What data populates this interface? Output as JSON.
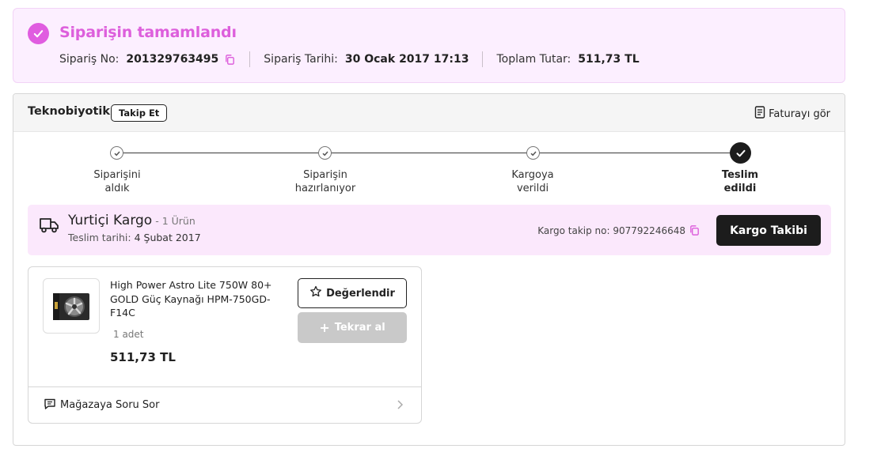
{
  "banner": {
    "title": "Siparişin tamamlandı",
    "order_no_label": "Sipariş No:",
    "order_no": "201329763495",
    "order_date_label": "Sipariş Tarihi:",
    "order_date": "30 Ocak 2017 17:13",
    "total_label": "Toplam Tutar:",
    "total": "511,73 TL",
    "accent_color": "#e05ce0"
  },
  "store": {
    "name": "Teknobiyotik",
    "follow_label": "Takip Et",
    "invoice_label": "Faturayı gör"
  },
  "tracker": {
    "steps": [
      {
        "line1": "Siparişini",
        "line2": "aldık",
        "done": true
      },
      {
        "line1": "Siparişin",
        "line2": "hazırlanıyor",
        "done": true
      },
      {
        "line1": "Kargoya",
        "line2": "verildi",
        "done": true
      },
      {
        "line1": "Teslim",
        "line2": "edildi",
        "done": true,
        "current": true
      }
    ]
  },
  "shipment": {
    "carrier": "Yurtiçi Kargo",
    "item_count": "- 1 Ürün",
    "delivery_label": "Teslim tarihi:",
    "delivery_date": "4 Şubat 2017",
    "tracking_label": "Kargo takip no:",
    "tracking_no": "907792246648",
    "track_button": "Kargo Takibi"
  },
  "product": {
    "name": "High Power Astro Lite 750W 80+ GOLD Güç Kaynağı HPM-750GD-F14C",
    "quantity": "1 adet",
    "price": "511,73 TL",
    "rate_button": "Değerlendir",
    "rebuy_button": "Tekrar al",
    "ask_store": "Mağazaya Soru Sor"
  }
}
